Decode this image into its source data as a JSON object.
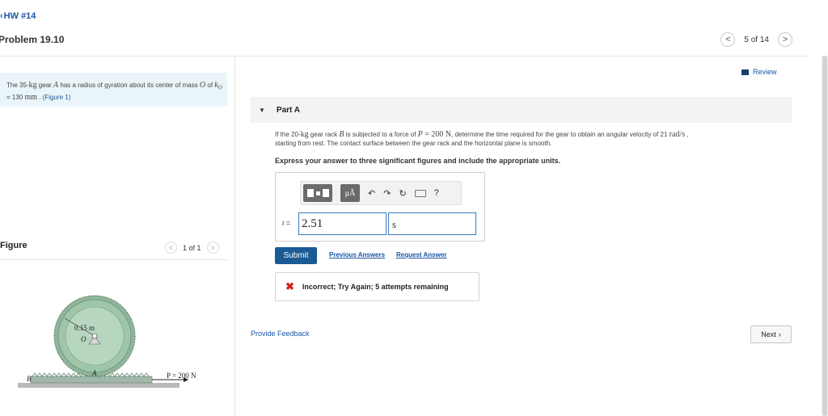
{
  "header": {
    "back_label": "HW #14",
    "problem_title": "Problem 19.10",
    "pager_text": "5 of 14"
  },
  "problem": {
    "text_before_mass": "The 35-",
    "mass_unit": "kg",
    "text_mid": " gear ",
    "gear_symbol": "A",
    "text_after": " has a radius of gyration about its center of mass ",
    "center_symbol": "O",
    "text_of": " of ",
    "k_symbol": "k",
    "k_sub": "O",
    "k_value": " = 130 ",
    "k_unit": "mm",
    "figure_link": "(Figure 1)"
  },
  "figure_panel": {
    "label": "Figure",
    "pager_text": "1 of 1",
    "radius_label": "0.15 m",
    "center_label": "O",
    "gear_label": "A",
    "rack_label": "B",
    "force_label": "P = 200 N"
  },
  "review": {
    "label": "Review"
  },
  "part": {
    "label": "Part A"
  },
  "question": {
    "q1": "If the 20-",
    "q_kg": "kg",
    "q2": " gear rack ",
    "q_B": "B",
    "q3": " is subjected to a force of ",
    "q_P": "P",
    "q_eq": " = 200 ",
    "q_N": "N",
    "q4": ", determine the time required for the gear to obtain an angular velocity of 21 ",
    "q_unit": "rad/s",
    "q5": " ,",
    "q6": "starting from rest. The contact surface between the gear rack and the horizontal plane is smooth."
  },
  "instruction": "Express your answer to three significant figures and include the appropriate units.",
  "answer": {
    "var_label": "t",
    "var_eq": " =",
    "value": "2.51",
    "unit": "s",
    "toolbar_mu": "μÅ",
    "help": "?"
  },
  "actions": {
    "submit": "Submit",
    "previous_answers": "Previous Answers",
    "request_answer": "Request Answer"
  },
  "feedback": {
    "icon": "✖",
    "text": "Incorrect; Try Again; 5 attempts remaining"
  },
  "footer": {
    "provide_feedback": "Provide Feedback",
    "next": "Next"
  },
  "colors": {
    "link": "#1a55a6",
    "submit_bg": "#1a5b96",
    "problem_box_bg": "#e9f5f8",
    "error": "#d0261e"
  }
}
